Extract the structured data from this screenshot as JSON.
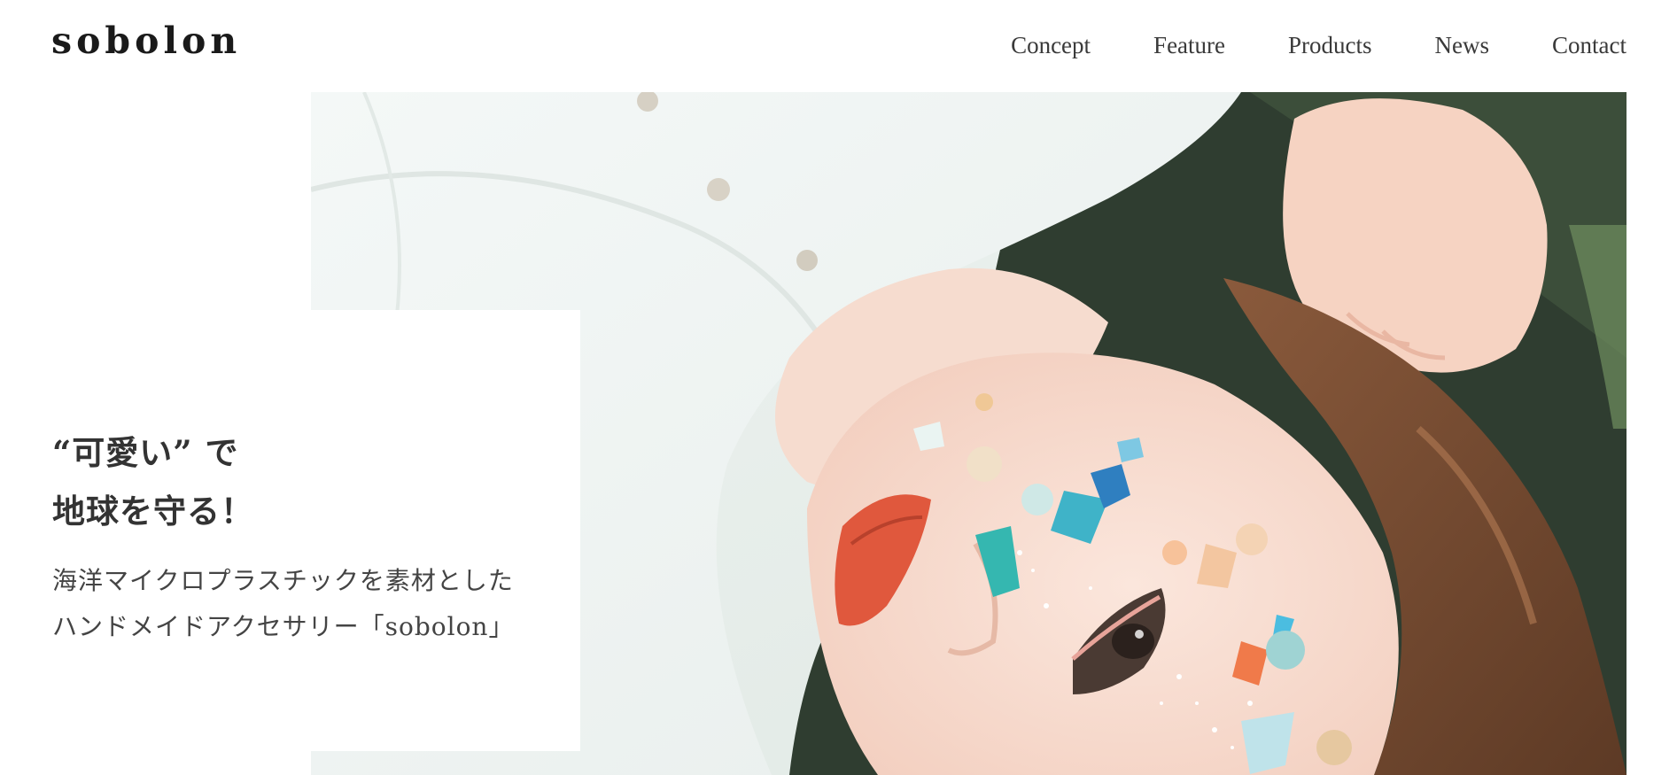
{
  "header": {
    "logo": "sobolon",
    "nav": [
      {
        "label": "Concept"
      },
      {
        "label": "Feature"
      },
      {
        "label": "Products"
      },
      {
        "label": "News"
      },
      {
        "label": "Contact"
      }
    ]
  },
  "hero": {
    "headline_lines": [
      "“可愛い” で",
      "地球を守る！"
    ],
    "subcopy_lines": [
      "海洋マイクロプラスチックを素材とした",
      "ハンドメイドアクセサリー「sobolon」"
    ]
  },
  "colors": {
    "background": "#ffffff",
    "text": "#333333",
    "accent_teal": "#3fb3c8",
    "accent_coral": "#e8553c"
  }
}
